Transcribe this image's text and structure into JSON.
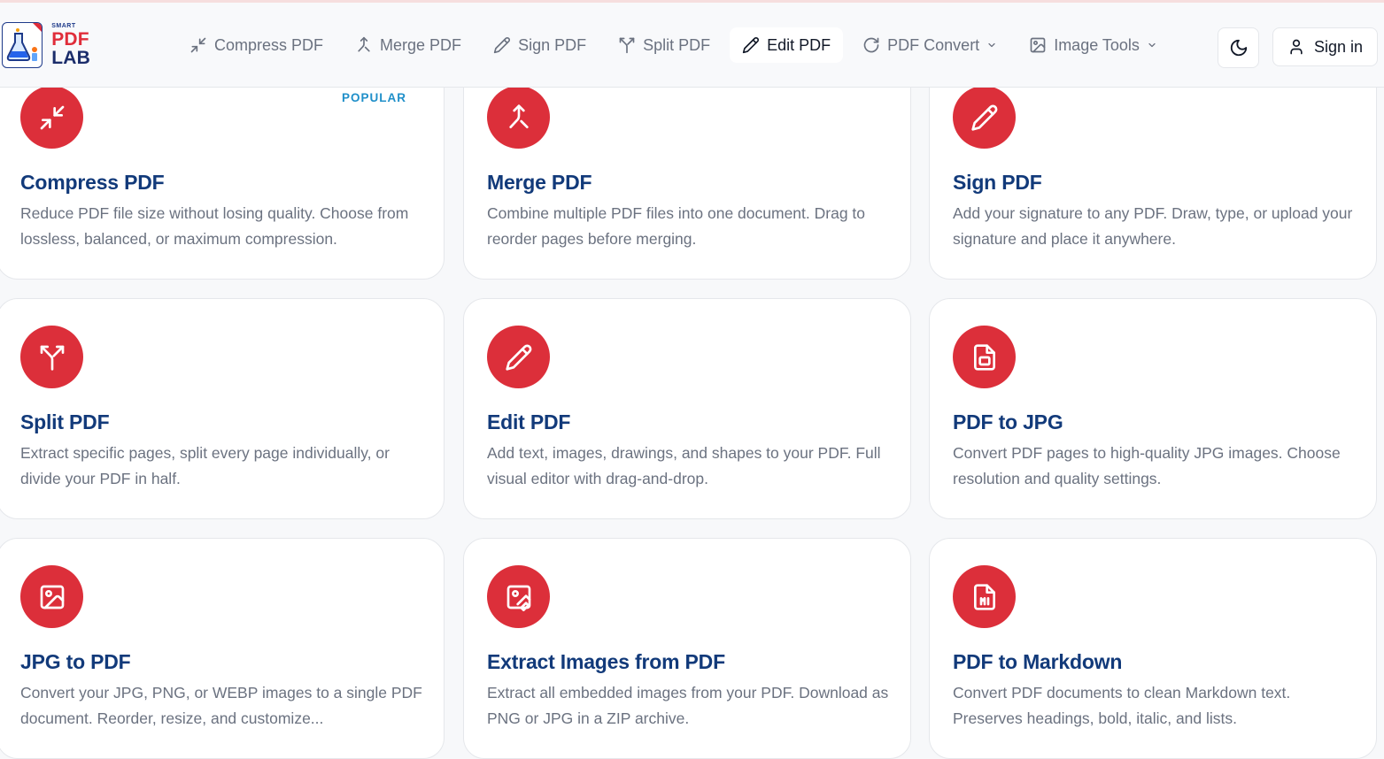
{
  "brand": {
    "small": "SMART",
    "main_red": "PDF",
    "main_navy": "LAB"
  },
  "nav": [
    {
      "label": "Compress PDF",
      "icon": "compress-icon"
    },
    {
      "label": "Merge PDF",
      "icon": "merge-icon"
    },
    {
      "label": "Sign PDF",
      "icon": "pen-icon"
    },
    {
      "label": "Split PDF",
      "icon": "split-icon"
    },
    {
      "label": "Edit PDF",
      "icon": "pencil-icon",
      "active": true
    },
    {
      "label": "PDF Convert",
      "icon": "refresh-icon",
      "dropdown": true
    },
    {
      "label": "Image Tools",
      "icon": "image-icon",
      "dropdown": true
    }
  ],
  "header": {
    "signin_label": "Sign in",
    "theme_icon": "moon-icon"
  },
  "cards": [
    {
      "title": "Compress PDF",
      "desc": "Reduce PDF file size without losing quality. Choose from lossless, balanced, or maximum compression.",
      "badge": "POPULAR",
      "icon": "compress-icon"
    },
    {
      "title": "Merge PDF",
      "desc": "Combine multiple PDF files into one document. Drag to reorder pages before merging.",
      "icon": "merge-icon"
    },
    {
      "title": "Sign PDF",
      "desc": "Add your signature to any PDF. Draw, type, or upload your signature and place it anywhere.",
      "icon": "pen-icon"
    },
    {
      "title": "Split PDF",
      "desc": "Extract specific pages, split every page individually, or divide your PDF in half.",
      "icon": "split-icon"
    },
    {
      "title": "Edit PDF",
      "desc": "Add text, images, drawings, and shapes to your PDF. Full visual editor with drag-and-drop.",
      "icon": "pencil-icon"
    },
    {
      "title": "PDF to JPG",
      "desc": "Convert PDF pages to high-quality JPG images. Choose resolution and quality settings.",
      "icon": "file-image-icon"
    },
    {
      "title": "JPG to PDF",
      "desc": "Convert your JPG, PNG, or WEBP images to a single PDF document. Reorder, resize, and customize...",
      "icon": "image-icon"
    },
    {
      "title": "Extract Images from PDF",
      "desc": "Extract all embedded images from your PDF. Download as PNG or JPG in a ZIP archive.",
      "icon": "image-edit-icon"
    },
    {
      "title": "PDF to Markdown",
      "desc": "Convert PDF documents to clean Markdown text. Preserves headings, bold, italic, and lists.",
      "icon": "file-markdown-icon"
    }
  ],
  "colors": {
    "accent_red": "#dc2f3a",
    "title_navy": "#123a7a",
    "badge_blue": "#1f8fc9"
  }
}
